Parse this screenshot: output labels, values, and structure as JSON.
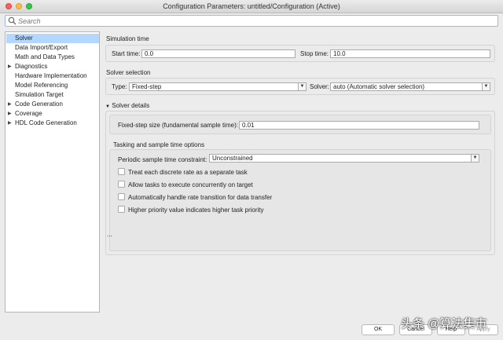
{
  "window": {
    "title": "Configuration Parameters: untitled/Configuration (Active)"
  },
  "search": {
    "placeholder": "Search"
  },
  "nav": {
    "items": [
      {
        "label": "Solver"
      },
      {
        "label": "Data Import/Export"
      },
      {
        "label": "Math and Data Types"
      },
      {
        "label": "Diagnostics"
      },
      {
        "label": "Hardware Implementation"
      },
      {
        "label": "Model Referencing"
      },
      {
        "label": "Simulation Target"
      },
      {
        "label": "Code Generation"
      },
      {
        "label": "Coverage"
      },
      {
        "label": "HDL Code Generation"
      }
    ]
  },
  "simulation_time": {
    "title": "Simulation time",
    "start_label": "Start time:",
    "start_value": "0.0",
    "stop_label": "Stop time:",
    "stop_value": "10.0"
  },
  "solver_selection": {
    "title": "Solver selection",
    "type_label": "Type:",
    "type_value": "Fixed-step",
    "solver_label": "Solver:",
    "solver_value": "auto (Automatic solver selection)"
  },
  "solver_details": {
    "title": "Solver details",
    "step_size_label": "Fixed-step size (fundamental sample time):",
    "step_size_value": "0.01",
    "tasking_title": "Tasking and sample time options",
    "constraint_label": "Periodic sample time constraint:",
    "constraint_value": "Unconstrained",
    "options": [
      {
        "label": "Treat each discrete rate as a separate task"
      },
      {
        "label": "Allow tasks to execute concurrently on target"
      },
      {
        "label": "Automatically handle rate transition for data transfer"
      },
      {
        "label": "Higher priority value indicates higher task priority"
      }
    ]
  },
  "more": "...",
  "buttons": {
    "ok": "OK",
    "cancel": "Cancel",
    "help": "Help",
    "apply": "Apply"
  },
  "watermark": "头条 @算法集市"
}
